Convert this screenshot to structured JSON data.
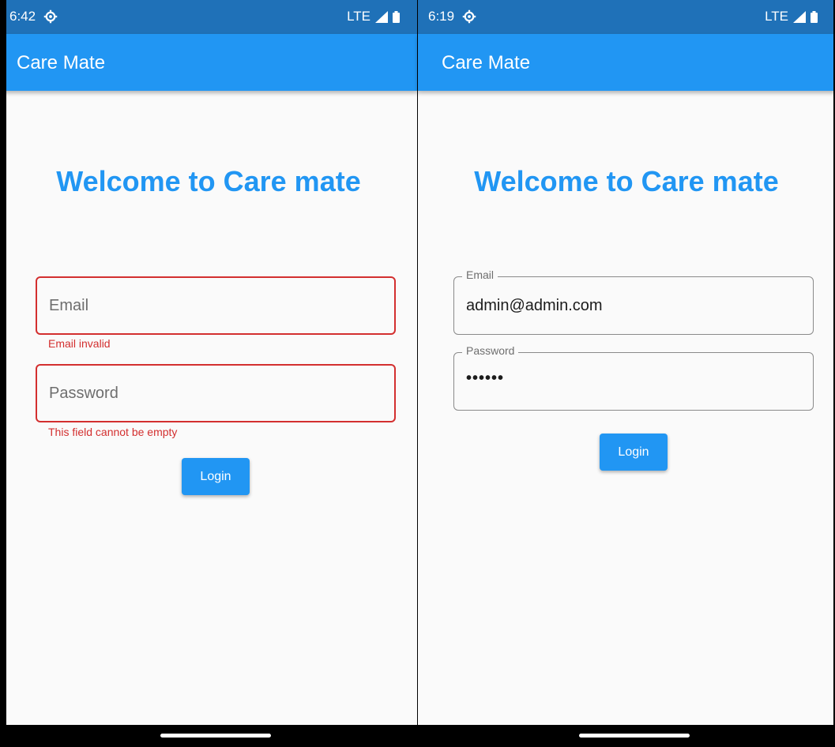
{
  "left": {
    "status": {
      "time": "6:42",
      "network": "LTE"
    },
    "app_title": "Care Mate",
    "welcome": "Welcome to Care mate",
    "email": {
      "placeholder": "Email",
      "error": "Email invalid"
    },
    "password": {
      "placeholder": "Password",
      "error": "This field cannot be empty"
    },
    "login_label": "Login"
  },
  "right": {
    "status": {
      "time": "6:19",
      "network": "LTE"
    },
    "app_title": "Care Mate",
    "welcome": "Welcome to Care mate",
    "email": {
      "label": "Email",
      "value": "admin@admin.com"
    },
    "password": {
      "label": "Password",
      "value": "••••••"
    },
    "login_label": "Login"
  },
  "colors": {
    "primary": "#2196f3",
    "status_bar": "#1f71b8",
    "error": "#d32f2f",
    "background": "#fafafa"
  },
  "icons": [
    "settings-gear-icon",
    "signal-icon",
    "battery-icon"
  ]
}
